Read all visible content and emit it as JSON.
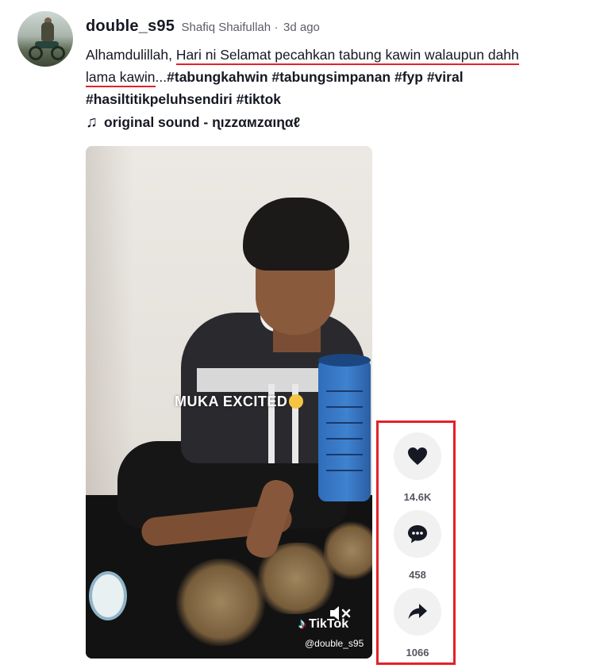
{
  "post": {
    "username": "double_s95",
    "nickname": "Shafiq Shaifullah",
    "separator": "·",
    "time_ago": "3d ago",
    "caption": {
      "lead": "Alhamdulillah, ",
      "underlined_1": "Hari ni Selamat pecahkan tabung kawin walaupun dahh",
      "underlined_2": "lama kawin",
      "ellipsis": "...",
      "hashtags_line1": "#tabungkahwin #tabungsimpanan #fyp #viral",
      "hashtags_line2": "#hasiltitikpeluhsendiri #tiktok"
    },
    "music": {
      "icon": "music-note-icon",
      "label": "original sound - ɳızzαмzαıɳαℓ"
    }
  },
  "video": {
    "overlay_text": "MUKA EXCITED",
    "brand": "TikTok",
    "watermark": "@double_s95",
    "muted": true
  },
  "actions": {
    "like_count": "14.6K",
    "comment_count": "458",
    "share_count": "1066",
    "highlight_color": "#e3212a"
  }
}
